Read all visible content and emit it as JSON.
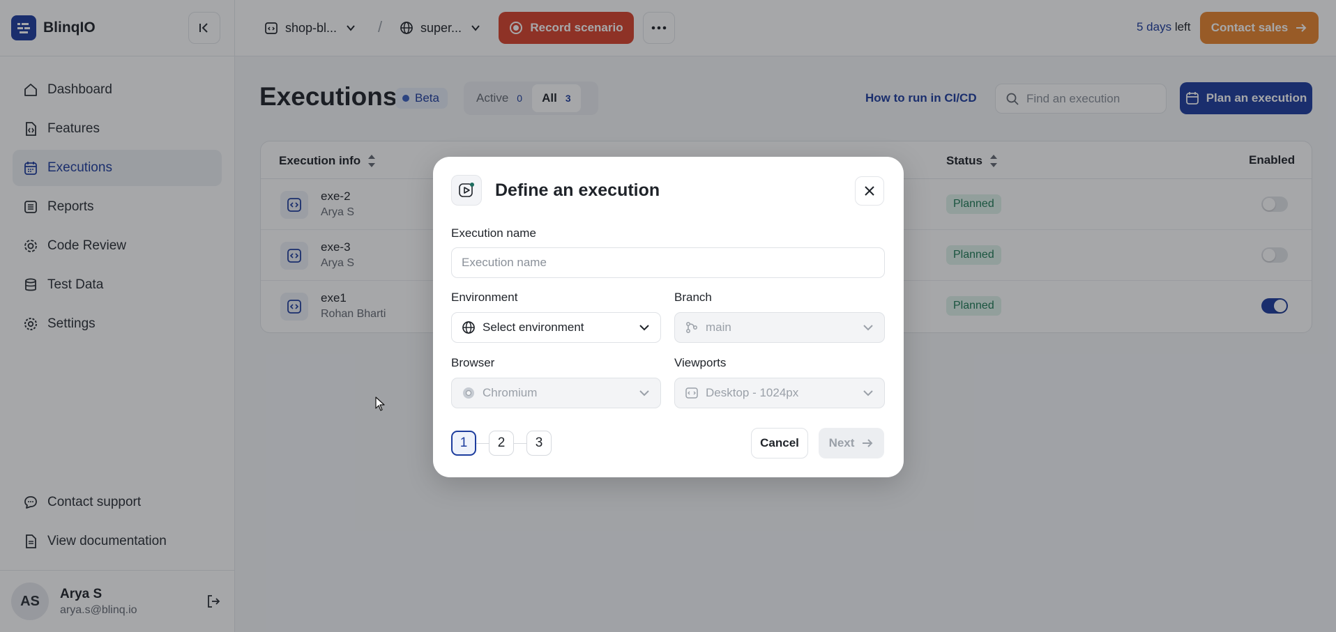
{
  "app": {
    "logo_text": "BlinqIO",
    "brand_color": "#1d3d9e",
    "accent_record": "#d9432c",
    "accent_sales": "#e8852e"
  },
  "sidebar": {
    "items": [
      {
        "label": "Dashboard",
        "icon": "home-icon"
      },
      {
        "label": "Features",
        "icon": "file-code-icon"
      },
      {
        "label": "Executions",
        "icon": "calendar-icon",
        "active": true
      },
      {
        "label": "Reports",
        "icon": "list-icon"
      },
      {
        "label": "Code Review",
        "icon": "gear-icon"
      },
      {
        "label": "Test Data",
        "icon": "database-icon"
      },
      {
        "label": "Settings",
        "icon": "settings-icon"
      }
    ],
    "bottom": [
      {
        "label": "Contact support",
        "icon": "chat-icon"
      },
      {
        "label": "View documentation",
        "icon": "document-icon"
      }
    ],
    "user": {
      "initials": "AS",
      "name": "Arya S",
      "email": "arya.s@blinq.io"
    }
  },
  "topbar": {
    "project": "shop-bl...",
    "environment": "super...",
    "record_label": "Record scenario",
    "trial_days": "5 days",
    "trial_suffix": "left",
    "contact_sales": "Contact sales"
  },
  "main": {
    "title": "Executions",
    "beta": "Beta",
    "tabs": [
      {
        "label": "Active",
        "count": "0"
      },
      {
        "label": "All",
        "count": "3",
        "active": true
      }
    ],
    "ci_link": "How to run in CI/CD",
    "search_placeholder": "Find an execution",
    "plan_button": "Plan an execution",
    "table": {
      "headers": {
        "info": "Execution info",
        "status": "Status",
        "enabled": "Enabled"
      },
      "rows": [
        {
          "name": "exe-2",
          "owner": "Arya S",
          "status": "Planned",
          "enabled": false
        },
        {
          "name": "exe-3",
          "owner": "Arya S",
          "status": "Planned",
          "enabled": false
        },
        {
          "name": "exe1",
          "owner": "Rohan Bharti",
          "status": "Planned",
          "enabled": true
        }
      ]
    }
  },
  "modal": {
    "title": "Define an execution",
    "name_label": "Execution name",
    "name_placeholder": "Execution name",
    "environment_label": "Environment",
    "environment_value": "Select environment",
    "branch_label": "Branch",
    "branch_value": "main",
    "browser_label": "Browser",
    "browser_value": "Chromium",
    "viewports_label": "Viewports",
    "viewports_value": "Desktop - 1024px",
    "steps": [
      "1",
      "2",
      "3"
    ],
    "cancel": "Cancel",
    "next": "Next"
  }
}
